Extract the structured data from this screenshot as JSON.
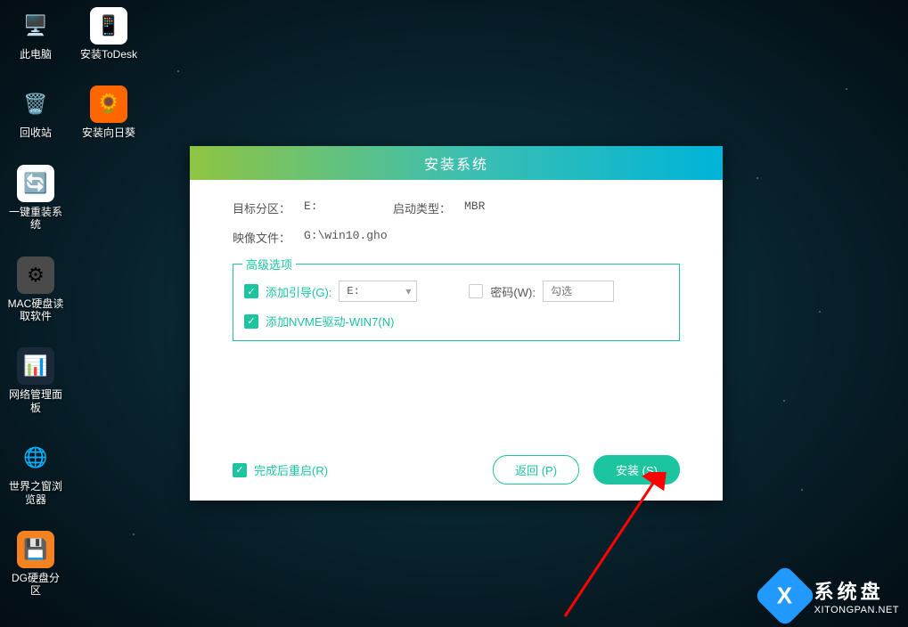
{
  "desktop": {
    "col1": [
      {
        "label": "此电脑",
        "bg": "transparent",
        "glyph": "🖥️"
      },
      {
        "label": "回收站",
        "bg": "transparent",
        "glyph": "🗑️"
      },
      {
        "label": "一键重装系统",
        "bg": "#fff",
        "glyph": "🔄"
      },
      {
        "label": "MAC硬盘读取软件",
        "bg": "#4a4a4a",
        "glyph": "⚙"
      },
      {
        "label": "网络管理面板",
        "bg": "#1a2a3a",
        "glyph": "📊"
      },
      {
        "label": "世界之窗浏览器",
        "bg": "transparent",
        "glyph": "🌐"
      },
      {
        "label": "DG硬盘分区",
        "bg": "#f58220",
        "glyph": "💾"
      }
    ],
    "col2": [
      {
        "label": "安装ToDesk",
        "bg": "#fff",
        "glyph": "📱"
      },
      {
        "label": "安装向日葵",
        "bg": "#ff6600",
        "glyph": "🌻"
      }
    ]
  },
  "dialog": {
    "title": "安装系统",
    "target_partition_label": "目标分区：",
    "target_partition_value": "E:",
    "boot_type_label": "启动类型：",
    "boot_type_value": "MBR",
    "image_file_label": "映像文件：",
    "image_file_value": "G:\\win10.gho",
    "advanced_label": "高级选项",
    "add_boot_label": "添加引导(G):",
    "add_boot_value": "E:",
    "password_label": "密码(W):",
    "password_placeholder": "勾选",
    "add_nvme_label": "添加NVME驱动-WIN7(N)",
    "restart_label": "完成后重启(R)",
    "back_button": "返回 (P)",
    "install_button": "安装 (S)"
  },
  "watermark": {
    "title": "系统盘",
    "url": "XITONGPAN.NET"
  }
}
